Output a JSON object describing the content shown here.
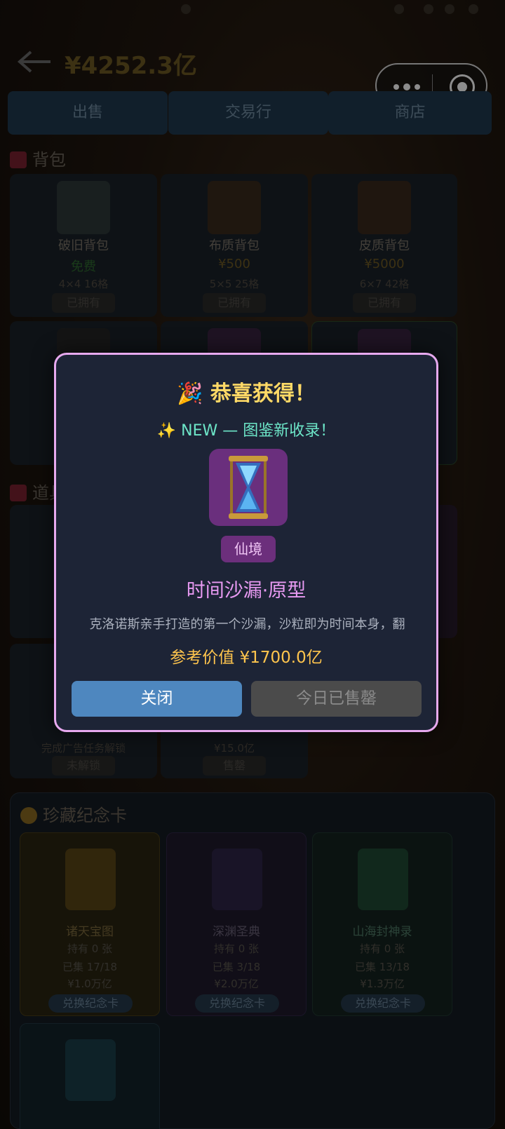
{
  "header": {
    "balance": "¥4252.3亿"
  },
  "tabs": [
    {
      "label": "出售"
    },
    {
      "label": "交易行"
    },
    {
      "label": "商店"
    }
  ],
  "backpack": {
    "title": "背包",
    "items": [
      {
        "name": "破旧背包",
        "price": "免费",
        "spec": "4×4 16格",
        "status": "已拥有"
      },
      {
        "name": "布质背包",
        "price": "¥500",
        "spec": "5×5 25格",
        "status": "已拥有"
      },
      {
        "name": "皮质背包",
        "price": "¥5000",
        "spec": "6×7 42格",
        "status": "已拥有"
      }
    ]
  },
  "props": {
    "title": "道具",
    "locked_card": {
      "lock_hint": "完成广告任务解锁",
      "status": "未解锁"
    },
    "sold_card": {
      "price": "¥15.0亿",
      "status": "售罄"
    }
  },
  "memorial": {
    "title": "珍藏纪念卡",
    "cards": [
      {
        "name": "诸天宝图",
        "held": "持有 0 张",
        "collected": "已集 17/18",
        "price": "¥1.0万亿",
        "button": "兑换纪念卡"
      },
      {
        "name": "深渊圣典",
        "held": "持有 0 张",
        "collected": "已集 3/18",
        "price": "¥2.0万亿",
        "button": "兑换纪念卡"
      },
      {
        "name": "山海封神录",
        "held": "持有 0 张",
        "collected": "已集 13/18",
        "price": "¥1.3万亿",
        "button": "兑换纪念卡"
      }
    ]
  },
  "modal": {
    "title": "🎉 恭喜获得！",
    "new_label": "✨ NEW — 图鉴新收录！",
    "rarity": "仙境",
    "item_name": "时间沙漏·原型",
    "description": "克洛诺斯亲手打造的第一个沙漏，沙粒即为时间本身，翻",
    "value": "参考价值 ¥1700.0亿",
    "close_label": "关闭",
    "soldout_label": "今日已售罄"
  },
  "colors": {
    "modal_border": "#e7a9ef",
    "title_gold": "#ffd966",
    "new_teal": "#6de6c8",
    "rarity_purple": "#e89af2",
    "close_blue": "#4e87bf"
  }
}
